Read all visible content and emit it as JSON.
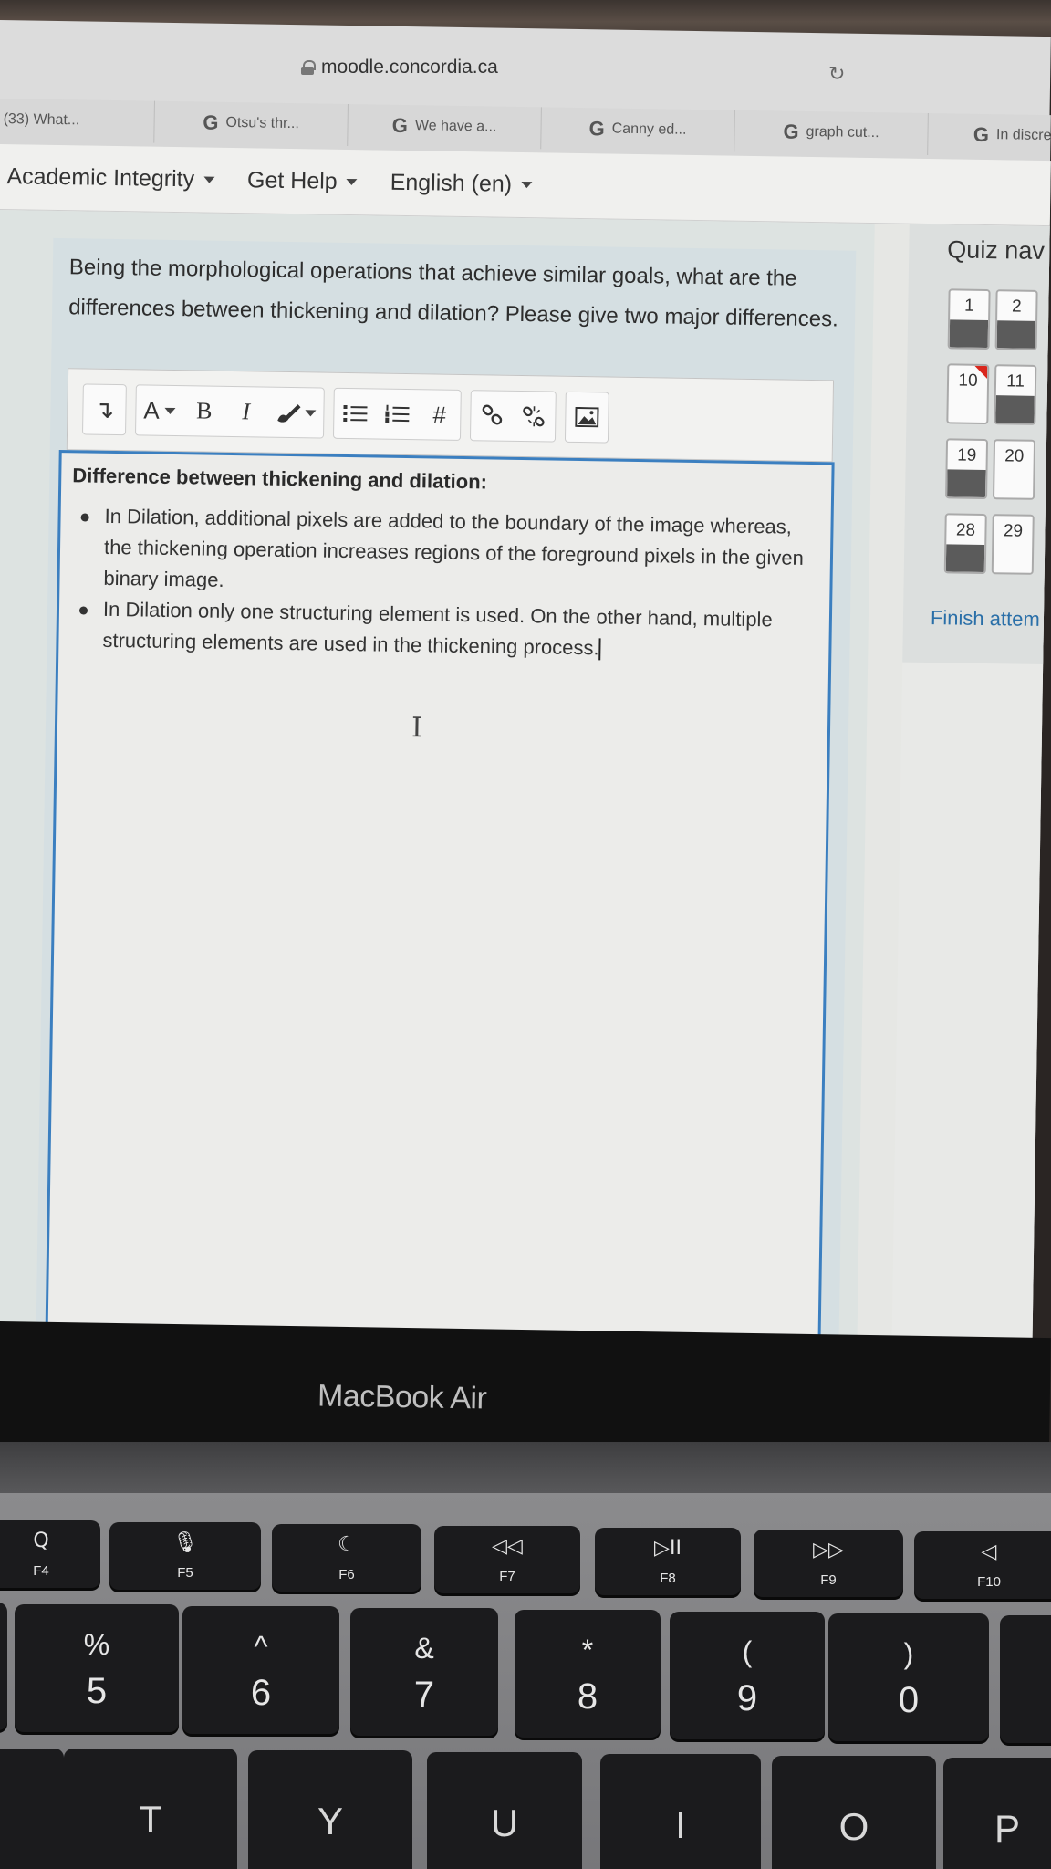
{
  "browser": {
    "url": "moodle.concordia.ca",
    "tabs": [
      {
        "label": "(33) What...",
        "icon": ""
      },
      {
        "label": "Otsu's thr...",
        "icon": "G"
      },
      {
        "label": "We have a...",
        "icon": "G"
      },
      {
        "label": "Canny ed...",
        "icon": "G"
      },
      {
        "label": "graph cut...",
        "icon": "G"
      },
      {
        "label": "In discrete...",
        "icon": "G"
      }
    ]
  },
  "navbar": {
    "academic_integrity": "Academic Integrity",
    "get_help": "Get Help",
    "language": "English (en)"
  },
  "question": {
    "text": "Being the morphological operations that achieve similar goals, what are the differences between thickening and dilation? Please give two major differences."
  },
  "toolbar": {
    "expand": "↴",
    "font": "A",
    "bold": "B",
    "italic": "I",
    "hash": "#"
  },
  "editor": {
    "heading": "Difference between thickening and dilation:",
    "bullets": [
      "In Dilation, additional pixels are added to the boundary of the image whereas, the thickening operation increases regions of the foreground pixels in the given binary image.",
      "In Dilation only one structuring element is used. On the other hand, multiple structuring elements are used in the thickening process."
    ]
  },
  "quiz_nav": {
    "title": "Quiz nav",
    "questions": [
      "1",
      "2",
      "10",
      "11",
      "19",
      "20",
      "28",
      "29"
    ],
    "finish": "Finish attem"
  },
  "laptop": {
    "brand": "MacBook Air",
    "fkeys": [
      {
        "icon": "Q",
        "label": "F4"
      },
      {
        "icon": "🎙",
        "label": "F5"
      },
      {
        "icon": "☾",
        "label": "F6"
      },
      {
        "icon": "◁◁",
        "label": "F7"
      },
      {
        "icon": "▷II",
        "label": "F8"
      },
      {
        "icon": "▷▷",
        "label": "F9"
      },
      {
        "icon": "◁",
        "label": "F10"
      }
    ],
    "number_keys": [
      {
        "top": "%",
        "bottom": "5"
      },
      {
        "top": "^",
        "bottom": "6"
      },
      {
        "top": "&",
        "bottom": "7"
      },
      {
        "top": "*",
        "bottom": "8"
      },
      {
        "top": "(",
        "bottom": "9"
      },
      {
        "top": ")",
        "bottom": "0"
      }
    ],
    "letter_keys": [
      "T",
      "Y",
      "U",
      "I",
      "O",
      "P"
    ]
  },
  "colors": {
    "editor_border": "#3b7fc0",
    "flag": "#d9261c",
    "link": "#2a6fa8"
  }
}
